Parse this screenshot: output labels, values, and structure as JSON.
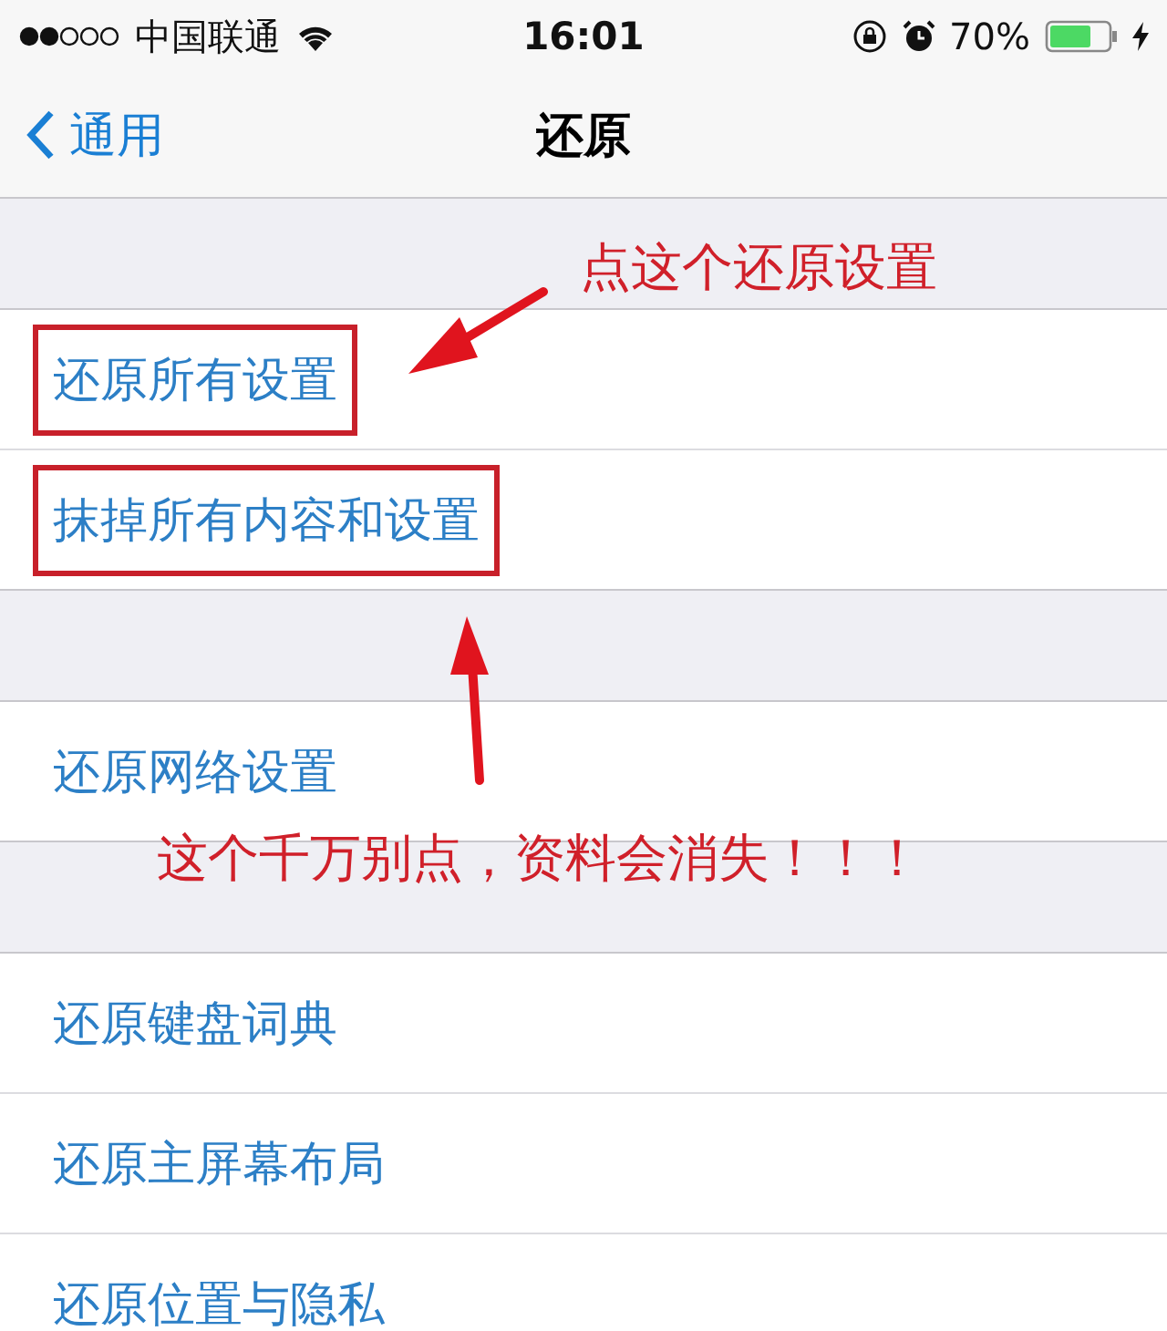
{
  "status_bar": {
    "carrier": "中国联通",
    "time": "16:01",
    "battery": "70%"
  },
  "nav": {
    "back": "通用",
    "title": "还原"
  },
  "groups": [
    {
      "items": [
        {
          "label": "还原所有设置",
          "highlighted": true
        },
        {
          "label": "抹掉所有内容和设置",
          "highlighted": true
        }
      ]
    },
    {
      "items": [
        {
          "label": "还原网络设置",
          "highlighted": false
        }
      ]
    },
    {
      "items": [
        {
          "label": "还原键盘词典",
          "highlighted": false
        },
        {
          "label": "还原主屏幕布局",
          "highlighted": false
        },
        {
          "label": "还原位置与隐私",
          "highlighted": false
        }
      ]
    }
  ],
  "annotations": [
    {
      "text": "点这个还原设置"
    },
    {
      "text": "这个千万别点，资料会消失！！！"
    }
  ]
}
